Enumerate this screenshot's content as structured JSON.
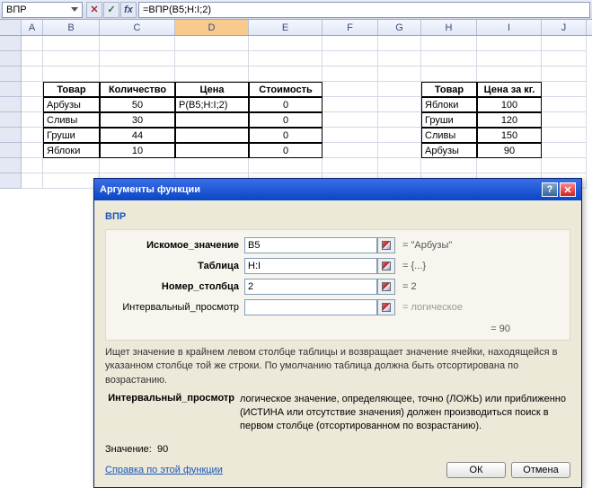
{
  "formula_bar": {
    "name_box": "ВПР",
    "cancel": "✕",
    "ok": "✓",
    "fx": "fx",
    "formula": "=ВПР(B5;H:I;2)"
  },
  "columns": [
    "A",
    "B",
    "C",
    "D",
    "E",
    "F",
    "G",
    "H",
    "I",
    "J"
  ],
  "table_left": {
    "headers": [
      "Товар",
      "Количество",
      "Цена",
      "Стоимость"
    ],
    "rows": [
      [
        "Арбузы",
        "50",
        "Р(B5;H:I;2)",
        "0"
      ],
      [
        "Сливы",
        "30",
        "",
        "0"
      ],
      [
        "Груши",
        "44",
        "",
        "0"
      ],
      [
        "Яблоки",
        "10",
        "",
        "0"
      ]
    ]
  },
  "table_right": {
    "headers": [
      "Товар",
      "Цена за кг."
    ],
    "rows": [
      [
        "Яблоки",
        "100"
      ],
      [
        "Груши",
        "120"
      ],
      [
        "Сливы",
        "150"
      ],
      [
        "Арбузы",
        "90"
      ]
    ]
  },
  "dialog": {
    "title": "Аргументы функции",
    "help_btn": "?",
    "close_btn": "✕",
    "fn": "ВПР",
    "args": [
      {
        "label": "Искомое_значение",
        "bold": true,
        "value": "B5",
        "result": "= \"Арбузы\""
      },
      {
        "label": "Таблица",
        "bold": true,
        "value": "H:I",
        "result": "= {...}"
      },
      {
        "label": "Номер_столбца",
        "bold": true,
        "value": "2",
        "result": "= 2"
      },
      {
        "label": "Интервальный_просмотр",
        "bold": false,
        "value": "",
        "result": "= логическое",
        "gray": true
      }
    ],
    "overall_result": "= 90",
    "description": "Ищет значение в крайнем левом столбце таблицы и возвращает значение ячейки, находящейся в указанном столбце той же строки. По умолчанию таблица должна быть отсортирована по возрастанию.",
    "param_label": "Интервальный_просмотр",
    "param_desc": "логическое значение, определяющее, точно (ЛОЖЬ) или приближенно (ИСТИНА или отсутствие значения) должен производиться поиск в первом столбце (отсортированном по возрастанию).",
    "value_label": "Значение:",
    "value": "90",
    "help_link": "Справка по этой функции",
    "ok": "ОК",
    "cancel": "Отмена"
  }
}
